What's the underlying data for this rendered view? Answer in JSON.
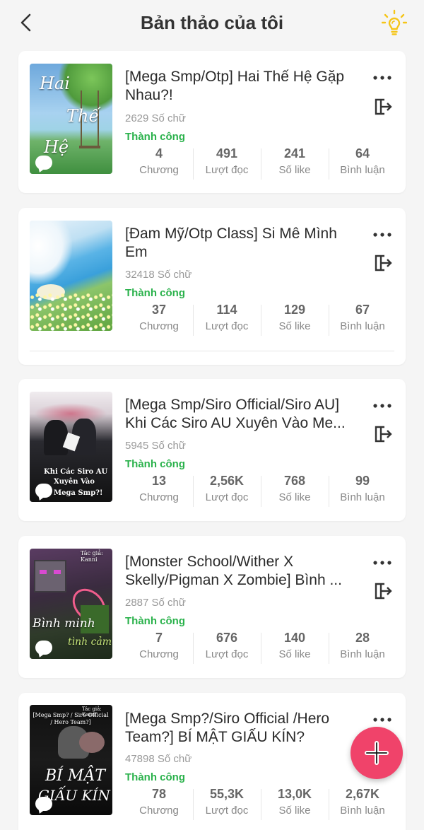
{
  "header": {
    "title": "Bản thảo của tôi",
    "back_icon": "back-arrow-icon",
    "tip_icon": "lightbulb-icon"
  },
  "colors": {
    "accent": "#f0436a",
    "success": "#2bb24c",
    "bulb": "#f5c518"
  },
  "stat_labels": {
    "chapters": "Chương",
    "reads": "Lượt đọc",
    "likes": "Số like",
    "comments": "Bình luận"
  },
  "stories": [
    {
      "title": "[Mega Smp/Otp] Hai Thế Hệ Gặp Nhau?!",
      "word_count": "2629 Số chữ",
      "status": "Thành công",
      "chapters": "4",
      "reads": "491",
      "likes": "241",
      "comments": "64",
      "cover_text": [
        "Hai",
        "Thế",
        "Hệ"
      ]
    },
    {
      "title": "[Đam Mỹ/Otp Class] Si Mê Mình Em",
      "word_count": "32418 Số chữ",
      "status": "Thành công",
      "chapters": "37",
      "reads": "114",
      "likes": "129",
      "comments": "67"
    },
    {
      "title": "[Mega Smp/Siro Official/Siro AU] Khi Các Siro AU Xuyên Vào Me...",
      "word_count": "5945 Số chữ",
      "status": "Thành công",
      "chapters": "13",
      "reads": "2,56K",
      "likes": "768",
      "comments": "99",
      "cover_text": [
        "Khi Các Siro AU",
        "Xuyên Vào",
        "Mega Smp?!"
      ]
    },
    {
      "title": "[Monster School/Wither X Skelly/Pigman X Zombie] Bình ...",
      "word_count": "2887 Số chữ",
      "status": "Thành công",
      "chapters": "7",
      "reads": "676",
      "likes": "140",
      "comments": "28",
      "cover_text": [
        "Tác giả: Kanni",
        "Bình minh",
        "tình cảm"
      ]
    },
    {
      "title": "[Mega Smp?/Siro Official /Hero Team?] BÍ MẬT GIẤU KÍN?",
      "word_count": "47898 Số chữ",
      "status": "Thành công",
      "chapters": "78",
      "reads": "55,3K",
      "likes": "13,0K",
      "comments": "2,67K",
      "cover_text": [
        "Tác giả: Kanni",
        "[Mega Smp? / Siro Official / Hero Team?]",
        "BÍ MẬT",
        "GIẤU KÍN"
      ]
    }
  ],
  "fab": {
    "icon": "plus-icon"
  }
}
